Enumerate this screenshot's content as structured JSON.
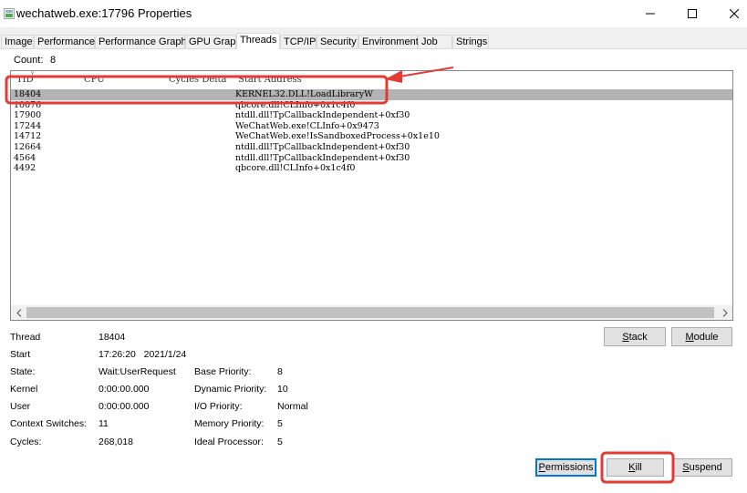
{
  "window": {
    "title": "wechatweb.exe:17796 Properties",
    "buttons": {
      "minimize": "minimize-icon",
      "maximize": "maximize-icon",
      "close": "close-icon"
    }
  },
  "tabs": [
    {
      "label": "Image"
    },
    {
      "label": "Performance"
    },
    {
      "label": "Performance Graph"
    },
    {
      "label": "GPU Graph"
    },
    {
      "label": "Threads",
      "active": true
    },
    {
      "label": "TCP/IP"
    },
    {
      "label": "Security"
    },
    {
      "label": "Environment"
    },
    {
      "label": "Job"
    },
    {
      "label": "Strings"
    }
  ],
  "threads": {
    "count_label": "Count:",
    "count": "8",
    "columns": [
      "TID",
      "CPU",
      "Cycles Delta",
      "Start Address"
    ],
    "rows": [
      {
        "tid": "18404",
        "cpu": "",
        "cycles": "",
        "address": "KERNEL32.DLL!LoadLibraryW",
        "selected": true
      },
      {
        "tid": "10076",
        "cpu": "",
        "cycles": "",
        "address": "qbcore.dll!CLInfo+0x1c4f0"
      },
      {
        "tid": "17900",
        "cpu": "",
        "cycles": "",
        "address": "ntdll.dll!TpCallbackIndependent+0xf30"
      },
      {
        "tid": "17244",
        "cpu": "",
        "cycles": "",
        "address": "WeChatWeb.exe!CLInfo+0x9473"
      },
      {
        "tid": "14712",
        "cpu": "",
        "cycles": "",
        "address": "WeChatWeb.exe!IsSandboxedProcess+0x1e10"
      },
      {
        "tid": "12664",
        "cpu": "",
        "cycles": "",
        "address": "ntdll.dll!TpCallbackIndependent+0xf30"
      },
      {
        "tid": "4564",
        "cpu": "",
        "cycles": "",
        "address": "ntdll.dll!TpCallbackIndependent+0xf30"
      },
      {
        "tid": "4492",
        "cpu": "",
        "cycles": "",
        "address": "qbcore.dll!CLInfo+0x1c4f0"
      }
    ]
  },
  "details": {
    "thread_label": "Thread",
    "thread": "18404",
    "start_label": "Start",
    "start": "17:26:20   2021/1/24",
    "state_label": "State:",
    "state": "Wait:UserRequest",
    "kernel_label": "Kernel",
    "kernel": "0:00:00.000",
    "user_label": "User",
    "user": "0:00:00.000",
    "context_label": "Context Switches:",
    "context": "11",
    "cycles_label": "Cycles:",
    "cycles": "268,018",
    "base_priority_label": "Base Priority:",
    "base_priority": "8",
    "dynamic_priority_label": "Dynamic Priority:",
    "dynamic_priority": "10",
    "io_priority_label": "I/O Priority:",
    "io_priority": "Normal",
    "memory_priority_label": "Memory Priority:",
    "memory_priority": "5",
    "ideal_processor_label": "Ideal Processor:",
    "ideal_processor": "5"
  },
  "buttons": {
    "stack_rest": "tack",
    "stack_key": "S",
    "module_rest": "odule",
    "module_key": "M",
    "permissions_rest": "ermissions",
    "permissions_key": "P",
    "kill_rest": "ill",
    "kill_key": "K",
    "suspend_rest": "uspend",
    "suspend_key": "S"
  },
  "colors": {
    "selection": "#b3b3b3",
    "annotation_red": "#e53935",
    "focus_blue": "#0078d7"
  }
}
